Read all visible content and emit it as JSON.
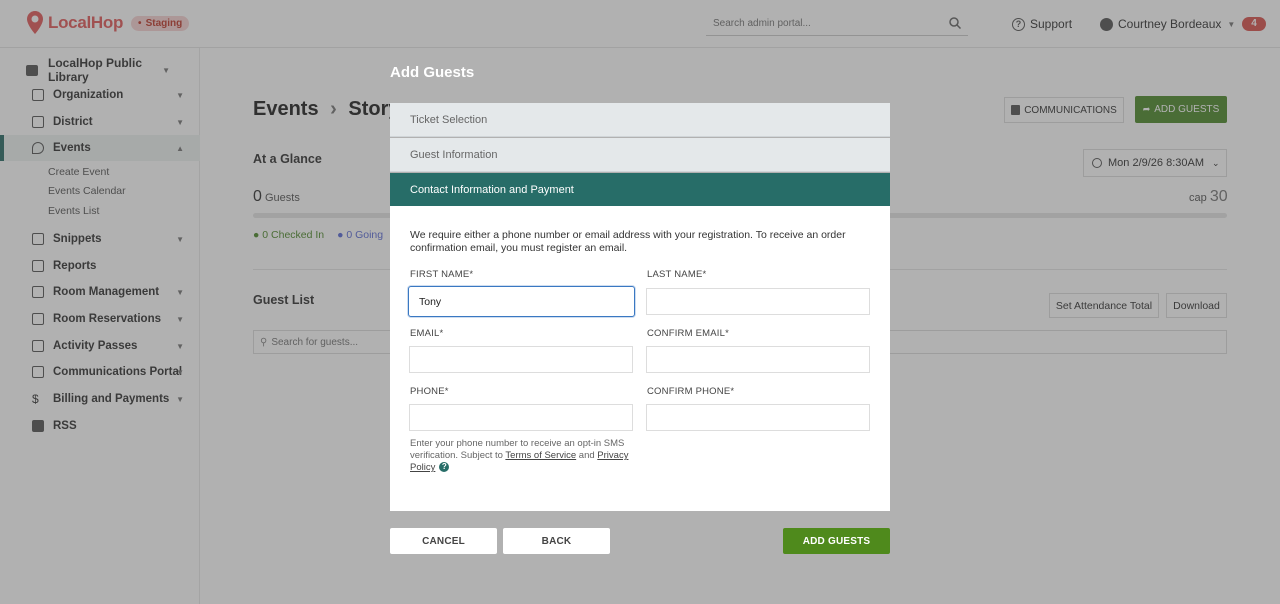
{
  "brand": {
    "logo_text": "LocalHop",
    "env_badge": "Staging"
  },
  "header": {
    "search_placeholder": "Search admin portal...",
    "support_label": "Support",
    "user_name": "Courtney Bordeaux",
    "notification_count": "4"
  },
  "sidebar": {
    "org_name": "LocalHop Public Library",
    "items": [
      {
        "label": "Organization"
      },
      {
        "label": "District"
      },
      {
        "label": "Events"
      },
      {
        "label": "Snippets"
      },
      {
        "label": "Reports"
      },
      {
        "label": "Room Management"
      },
      {
        "label": "Room Reservations"
      },
      {
        "label": "Activity Passes"
      },
      {
        "label": "Communications Portal"
      },
      {
        "label": "Billing and Payments"
      },
      {
        "label": "RSS"
      }
    ],
    "event_subitems": [
      {
        "label": "Create Event"
      },
      {
        "label": "Events Calendar"
      },
      {
        "label": "Events List"
      }
    ]
  },
  "main": {
    "breadcrumb_root": "Events",
    "breadcrumb_current": "Story",
    "communications_label": "COMMUNICATIONS",
    "add_guests_label": "ADD GUESTS",
    "at_a_glance": "At a Glance",
    "date_label": "Mon 2/9/26 8:30AM",
    "guest_count": "0",
    "guests_label": "Guests",
    "cap_label": "cap",
    "cap_value": "30",
    "checked_in": "0 Checked In",
    "going": "0 Going",
    "guest_list_title": "Guest List",
    "set_attendance_label": "Set Attendance Total",
    "download_label": "Download",
    "guest_search_placeholder": "Search for guests..."
  },
  "modal": {
    "title": "Add Guests",
    "sections": [
      {
        "label": "Ticket Selection"
      },
      {
        "label": "Guest Information"
      },
      {
        "label": "Contact Information and Payment"
      }
    ],
    "description": "We require either a phone number or email address with your registration. To receive an order confirmation email, you must register an email.",
    "fields": {
      "first_name": {
        "label": "FIRST NAME*",
        "value": "Tony"
      },
      "last_name": {
        "label": "LAST NAME*",
        "value": ""
      },
      "email": {
        "label": "EMAIL*",
        "value": ""
      },
      "confirm_email": {
        "label": "CONFIRM EMAIL*",
        "value": ""
      },
      "phone": {
        "label": "PHONE*",
        "value": ""
      },
      "confirm_phone": {
        "label": "CONFIRM PHONE*",
        "value": ""
      }
    },
    "hint_text_1": "Enter your phone number to receive an opt-in SMS verification. Subject to ",
    "terms_link": "Terms of Service",
    "hint_and": " and ",
    "privacy_link": "Privacy Policy",
    "cancel_label": "CANCEL",
    "back_label": "BACK",
    "submit_label": "ADD GUESTS"
  },
  "colors": {
    "accent_teal": "#276d68",
    "primary_green": "#4f8a1c",
    "brand_red": "#e25b5b"
  }
}
